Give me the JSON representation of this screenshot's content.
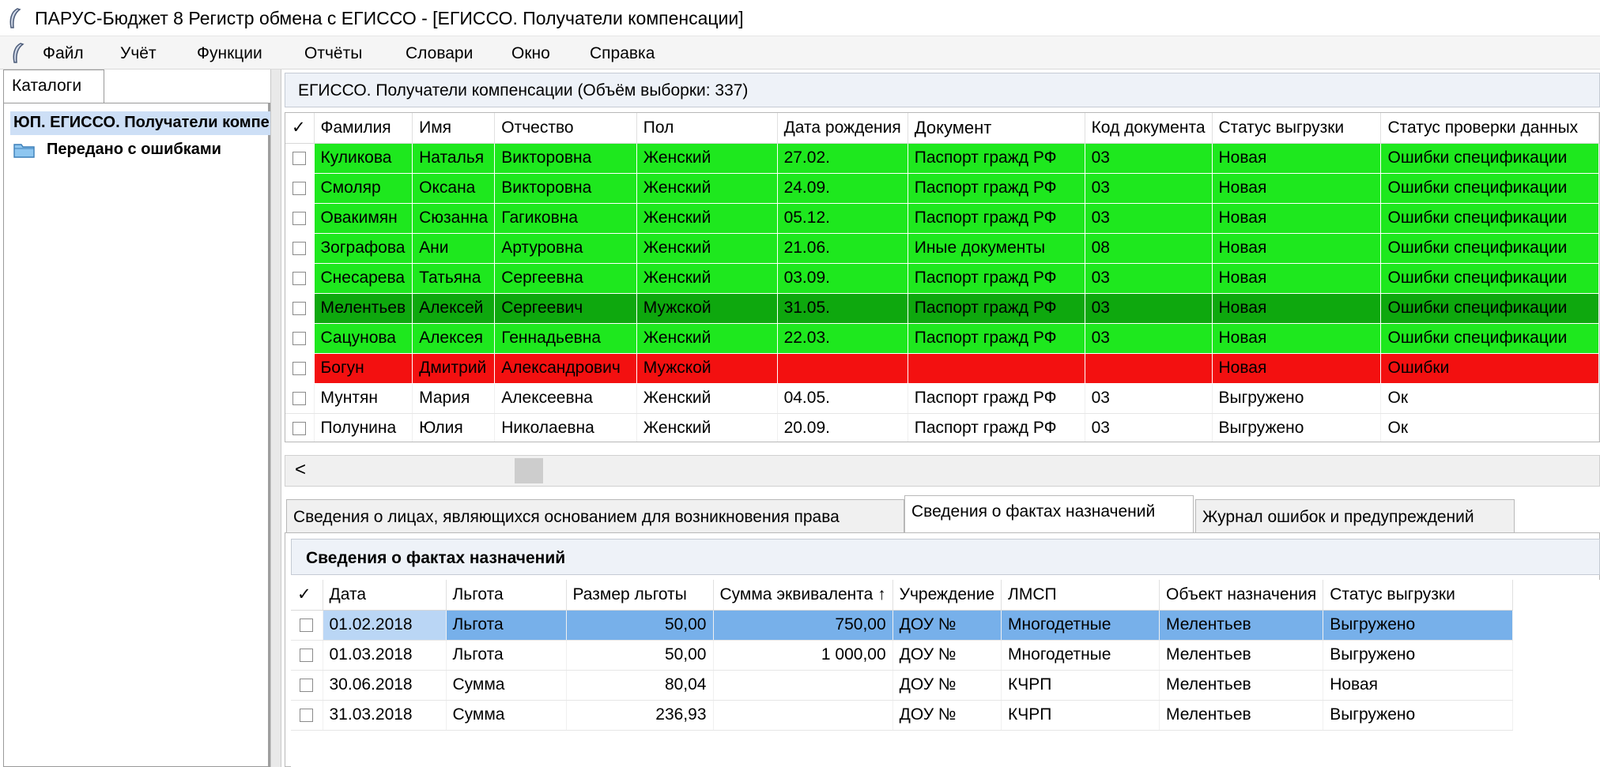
{
  "window": {
    "title": "ПАРУС-Бюджет 8 Регистр обмена с ЕГИССО - [ЕГИССО. Получатели компенсации]"
  },
  "menu": [
    "Файл",
    "Учёт",
    "Функции",
    "Отчёты",
    "Словари",
    "Окно",
    "Справка"
  ],
  "left": {
    "tab_label": "Каталоги",
    "tree_root": "ЮП. ЕГИССО. Получатели компенсации",
    "tree_child": "Передано с ошибками"
  },
  "top_panel": {
    "header": "ЕГИССО. Получатели компенсации (Объём выборки: 337)",
    "check_header": "✓",
    "columns": [
      "Фамилия",
      "Имя",
      "Отчество",
      "Пол",
      "Дата рождения",
      "Документ",
      "Код документа",
      "Статус выгрузки",
      "Статус проверки данных"
    ],
    "rows": [
      [
        "Куликова",
        "Наталья",
        "Викторовна",
        "Женский",
        "27.02.",
        "Паспорт гражд РФ",
        "03",
        "Новая",
        "Ошибки спецификации"
      ],
      [
        "Смоляр",
        "Оксана",
        "Викторовна",
        "Женский",
        "24.09.",
        "Паспорт гражд РФ",
        "03",
        "Новая",
        "Ошибки спецификации"
      ],
      [
        "Овакимян",
        "Сюзанна",
        "Гагиковна",
        "Женский",
        "05.12.",
        "Паспорт гражд РФ",
        "03",
        "Новая",
        "Ошибки спецификации"
      ],
      [
        "Зографова",
        "Ани",
        "Артуровна",
        "Женский",
        "21.06.",
        "Иные документы",
        "08",
        "Новая",
        "Ошибки спецификации"
      ],
      [
        "Снесарева",
        "Татьяна",
        "Сергеевна",
        "Женский",
        "03.09.",
        "Паспорт гражд РФ",
        "03",
        "Новая",
        "Ошибки спецификации"
      ],
      [
        "Мелентьев",
        "Алексей",
        "Сергеевич",
        "Мужской",
        "31.05.",
        "Паспорт гражд РФ",
        "03",
        "Новая",
        "Ошибки спецификации"
      ],
      [
        "Сацунова",
        "Алексея",
        "Геннадьевна",
        "Женский",
        "22.03.",
        "Паспорт гражд РФ",
        "03",
        "Новая",
        "Ошибки спецификации"
      ],
      [
        "Богун",
        "Дмитрий",
        "Александрович",
        "Мужской",
        "",
        "",
        "",
        "Новая",
        "Ошибки"
      ],
      [
        "Мунтян",
        "Мария",
        "Алексеевна",
        "Женский",
        "04.05.",
        "Паспорт гражд РФ",
        "03",
        "Выгружено",
        "Ок"
      ],
      [
        "Полунина",
        "Юлия",
        "Николаевна",
        "Женский",
        "20.09.",
        "Паспорт гражд РФ",
        "03",
        "Выгружено",
        "Ок"
      ]
    ],
    "row_colors": [
      "#1ee81e",
      "#1ee81e",
      "#1ee81e",
      "#1ee81e",
      "#1ee81e",
      "#0ea80e",
      "#1ee81e",
      "#f31010",
      "#ffffff",
      "#ffffff"
    ],
    "scroll_left": "<"
  },
  "tabs": [
    "Сведения о лицах, являющихся основанием для возникновения права",
    "Сведения о фактах назначений",
    "Журнал ошибок и предупреждений"
  ],
  "active_tab": 1,
  "bottom_panel": {
    "header": "Сведения о фактах назначений",
    "check_header": "✓",
    "columns": [
      "Дата",
      "Льгота",
      "Размер льготы",
      "Сумма эквивалента ↑",
      "Учреждение",
      "ЛМСП",
      "Объект назначения",
      "Статус выгрузки"
    ],
    "rows": [
      [
        "01.02.2018",
        "Льгота",
        "50,00",
        "750,00",
        "ДОУ №",
        "Многодетные",
        "Мелентьев",
        "Выгружено"
      ],
      [
        "01.03.2018",
        "Льгота",
        "50,00",
        "1 000,00",
        "ДОУ №",
        "Многодетные",
        "Мелентьев",
        "Выгружено"
      ],
      [
        "30.06.2018",
        "Сумма",
        "80,04",
        "",
        "ДОУ №",
        "КЧРП",
        "Мелентьев",
        "Новая"
      ],
      [
        "31.03.2018",
        "Сумма",
        "236,93",
        "",
        "ДОУ №",
        "КЧРП",
        "Мелентьев",
        "Выгружено"
      ]
    ],
    "selected_row": 0
  },
  "colors": {
    "green": "#1ee81e",
    "dark_green": "#0ea80e",
    "red": "#f31010",
    "selection": "#77b0ea"
  }
}
